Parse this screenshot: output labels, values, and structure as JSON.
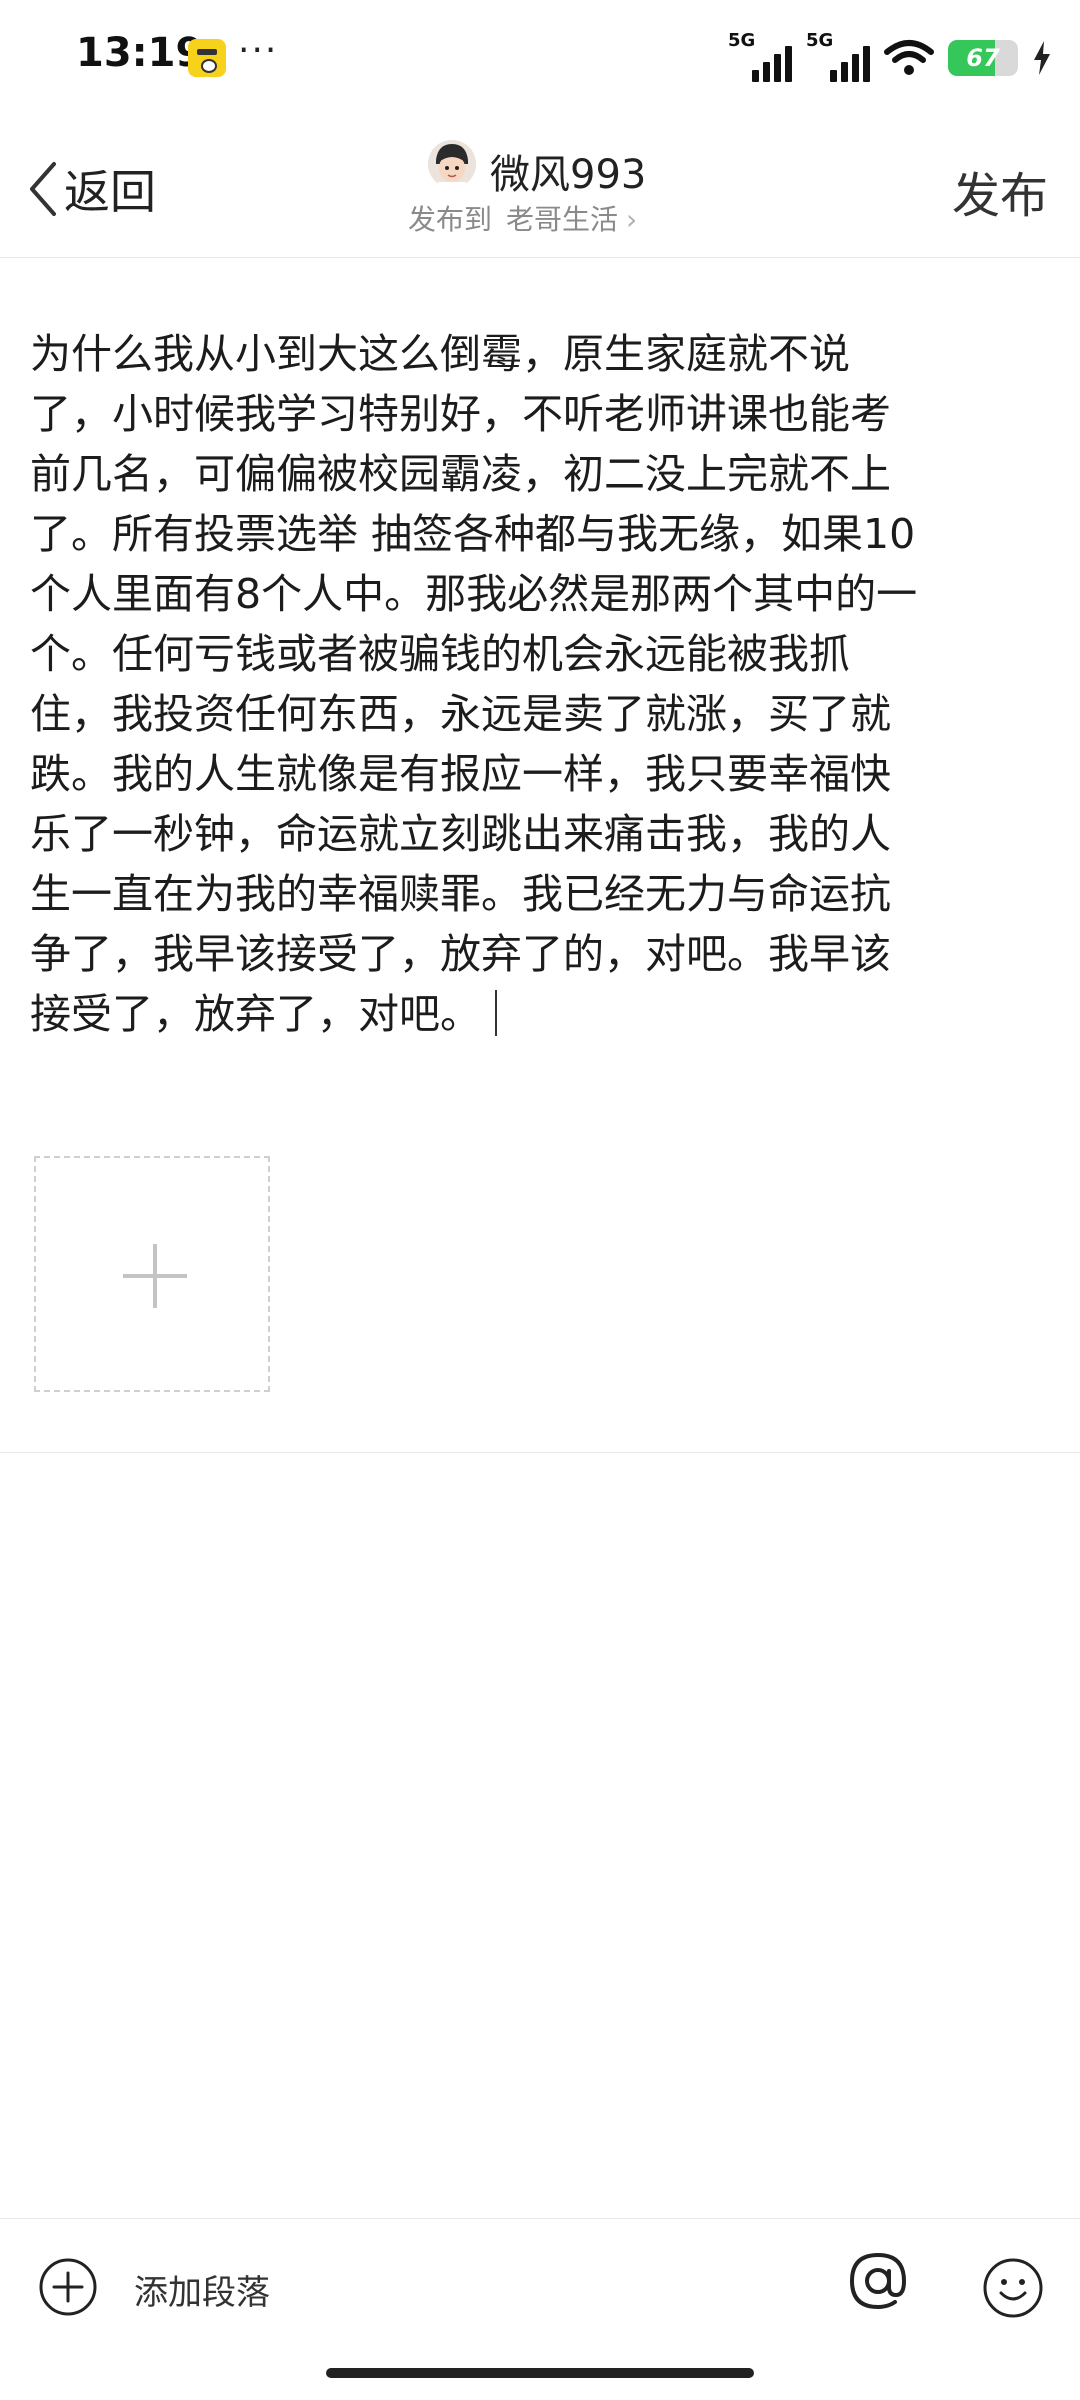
{
  "status_bar": {
    "time": "13:19",
    "more": "···",
    "signal1_label": "5G",
    "signal2_label": "5G",
    "battery_percent": "67",
    "battery_level": 0.67,
    "battery_color": "#35c759"
  },
  "header": {
    "back_label": "返回",
    "author_name": "微风993",
    "post_to_prefix": "发布到",
    "forum_name": "老哥生活",
    "publish_label": "发布"
  },
  "editor": {
    "text": "为什么我从小到大这么倒霉，原生家庭就不说了，小时候我学习特别好，不听老师讲课也能考前几名，可偏偏被校园霸凌，初二没上完就不上了。所有投票选举 抽签各种都与我无缘，如果10个人里面有8个人中。那我必然是那两个其中的一个。任何亏钱或者被骗钱的机会永远能被我抓住，我投资任何东西，永远是卖了就涨，买了就跌。我的人生就像是有报应一样，我只要幸福快乐了一秒钟，命运就立刻跳出来痛击我，我的人生一直在为我的幸福赎罪。我已经无力与命运抗争了，我早该接受了，放弃了的，对吧。我早该接受了，放弃了，对吧。"
  },
  "icons": {
    "back": "chevron-left-icon",
    "add_image": "plus-icon",
    "toolbar_add": "plus-circle-icon",
    "mention": "at-icon",
    "emoji": "smile-icon"
  },
  "toolbar": {
    "add_paragraph_label": "添加段落"
  }
}
